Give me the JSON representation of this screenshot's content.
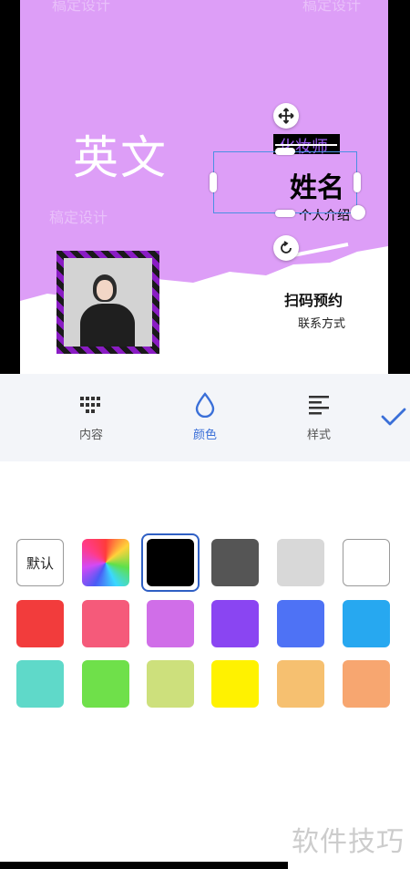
{
  "canvas": {
    "watermarks": [
      "稿定设计",
      "稿定设计",
      "稿定设计"
    ],
    "english_placeholder": "英文",
    "job_title": "化妆师",
    "name": "姓名",
    "intro": "个人介绍",
    "scan_label": "扫码预约",
    "contact_label": "联系方式",
    "background_color": "#dd9ef7",
    "selection_color": "#4a90e2",
    "icons": [
      "move-icon",
      "rotate-icon"
    ]
  },
  "toolbar": {
    "tabs": [
      {
        "label": "内容",
        "icon": "grid-dots-icon"
      },
      {
        "label": "颜色",
        "icon": "droplet-icon"
      },
      {
        "label": "样式",
        "icon": "text-align-icon"
      }
    ],
    "active_tab": "颜色",
    "confirm_icon": "check-icon",
    "accent_color": "#3a6fd8"
  },
  "colors": {
    "default_label": "默认",
    "selected": "#000000",
    "swatches": [
      "#000000",
      "#555555",
      "#d8d8d8",
      "#ffffff",
      "#f23c3c",
      "#f55a7a",
      "#d06ee8",
      "#8a45f2",
      "#4e72f5",
      "#27a8f0",
      "#5fd9c9",
      "#6fe04a",
      "#cde07c",
      "#fff200",
      "#f6c070",
      "#f7a670"
    ]
  },
  "footer": {
    "watermark": "软件技巧"
  }
}
